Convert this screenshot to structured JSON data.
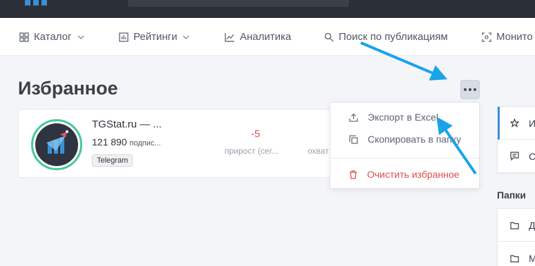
{
  "nav": {
    "items": [
      {
        "label": "Каталог",
        "icon": "grid-icon",
        "dropdown": true
      },
      {
        "label": "Рейтинги",
        "icon": "bar-chart-icon",
        "dropdown": true
      },
      {
        "label": "Аналитика",
        "icon": "line-chart-icon",
        "dropdown": false
      },
      {
        "label": "Поиск по публикациям",
        "icon": "search-icon",
        "dropdown": false
      },
      {
        "label": "Монито",
        "icon": "monitor-icon",
        "dropdown": false
      }
    ]
  },
  "page": {
    "title": "Избранное"
  },
  "channel": {
    "title": "TGStat.ru — ...",
    "subscribers": "121 890",
    "subscribers_label": "подпис...",
    "tag": "Telegram",
    "growth_value": "-5",
    "growth_label": "прирост (сег...",
    "reach_label": "охват"
  },
  "menu": {
    "export_label": "Экспорт в Excel",
    "copy_label": "Скопировать в папку",
    "clear_label": "Очистить избранное"
  },
  "sidebar": {
    "items": [
      {
        "label": "И",
        "icon": "star-icon"
      },
      {
        "label": "С",
        "icon": "comment-icon"
      }
    ],
    "folders_heading": "Папки",
    "folders": [
      {
        "label": "Д",
        "icon": "folder-icon"
      },
      {
        "label": "М",
        "icon": "folder-icon"
      }
    ]
  },
  "colors": {
    "accent": "#3d8fd6",
    "danger": "#e04b4b",
    "arrow": "#1aa3e8",
    "avatar_ring": "#46c79a"
  }
}
